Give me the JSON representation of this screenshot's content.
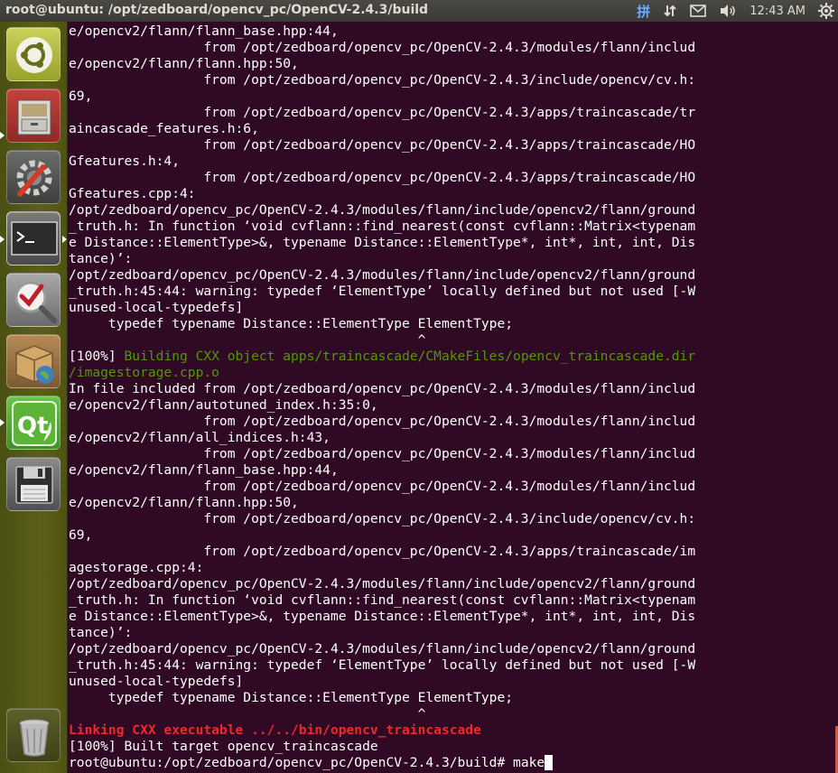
{
  "window": {
    "title": "root@ubuntu: /opt/zedboard/opencv_pc/OpenCV-2.4.3/build"
  },
  "indicators": {
    "keyboard": "拼",
    "clock": "12:43 AM"
  },
  "launcher": {
    "items": [
      {
        "name": "ubuntu-dash"
      },
      {
        "name": "file-manager"
      },
      {
        "name": "system-settings"
      },
      {
        "name": "terminal"
      },
      {
        "name": "qt-creator-check"
      },
      {
        "name": "software-center"
      },
      {
        "name": "qt-creator"
      },
      {
        "name": "save-disk"
      },
      {
        "name": "trash"
      }
    ]
  },
  "terminal": {
    "lines": [
      {
        "text": "e/opencv2/flann/flann_base.hpp:44,",
        "style": "normal"
      },
      {
        "text": "                 from /opt/zedboard/opencv_pc/OpenCV-2.4.3/modules/flann/includ",
        "style": "normal"
      },
      {
        "text": "e/opencv2/flann/flann.hpp:50,",
        "style": "normal"
      },
      {
        "text": "                 from /opt/zedboard/opencv_pc/OpenCV-2.4.3/include/opencv/cv.h:",
        "style": "normal"
      },
      {
        "text": "69,",
        "style": "normal"
      },
      {
        "text": "                 from /opt/zedboard/opencv_pc/OpenCV-2.4.3/apps/traincascade/tr",
        "style": "normal"
      },
      {
        "text": "aincascade_features.h:6,",
        "style": "normal"
      },
      {
        "text": "                 from /opt/zedboard/opencv_pc/OpenCV-2.4.3/apps/traincascade/HO",
        "style": "normal"
      },
      {
        "text": "Gfeatures.h:4,",
        "style": "normal"
      },
      {
        "text": "                 from /opt/zedboard/opencv_pc/OpenCV-2.4.3/apps/traincascade/HO",
        "style": "normal"
      },
      {
        "text": "Gfeatures.cpp:4:",
        "style": "normal"
      },
      {
        "text": "/opt/zedboard/opencv_pc/OpenCV-2.4.3/modules/flann/include/opencv2/flann/ground",
        "style": "normal"
      },
      {
        "text": "_truth.h: In function ‘void cvflann::find_nearest(const cvflann::Matrix<typenam",
        "style": "normal"
      },
      {
        "text": "e Distance::ElementType>&, typename Distance::ElementType*, int*, int, int, Dis",
        "style": "normal"
      },
      {
        "text": "tance)’:",
        "style": "normal"
      },
      {
        "text": "/opt/zedboard/opencv_pc/OpenCV-2.4.3/modules/flann/include/opencv2/flann/ground",
        "style": "normal"
      },
      {
        "text": "_truth.h:45:44: warning: typedef ‘ElementType’ locally defined but not used [-W",
        "style": "normal"
      },
      {
        "text": "unused-local-typedefs]",
        "style": "normal"
      },
      {
        "text": "     typedef typename Distance::ElementType ElementType;",
        "style": "normal"
      },
      {
        "text": "                                            ^",
        "style": "normal"
      },
      {
        "text": "[100%] Building CXX object apps/traincascade/CMakeFiles/opencv_traincascade.dir",
        "style": "green",
        "prefix": "[100%] "
      },
      {
        "text": "/imagestorage.cpp.o",
        "style": "green"
      },
      {
        "text": "In file included from /opt/zedboard/opencv_pc/OpenCV-2.4.3/modules/flann/includ",
        "style": "normal"
      },
      {
        "text": "e/opencv2/flann/autotuned_index.h:35:0,",
        "style": "normal"
      },
      {
        "text": "                 from /opt/zedboard/opencv_pc/OpenCV-2.4.3/modules/flann/includ",
        "style": "normal"
      },
      {
        "text": "e/opencv2/flann/all_indices.h:43,",
        "style": "normal"
      },
      {
        "text": "                 from /opt/zedboard/opencv_pc/OpenCV-2.4.3/modules/flann/includ",
        "style": "normal"
      },
      {
        "text": "e/opencv2/flann/flann_base.hpp:44,",
        "style": "normal"
      },
      {
        "text": "                 from /opt/zedboard/opencv_pc/OpenCV-2.4.3/modules/flann/includ",
        "style": "normal"
      },
      {
        "text": "e/opencv2/flann/flann.hpp:50,",
        "style": "normal"
      },
      {
        "text": "                 from /opt/zedboard/opencv_pc/OpenCV-2.4.3/include/opencv/cv.h:",
        "style": "normal"
      },
      {
        "text": "69,",
        "style": "normal"
      },
      {
        "text": "                 from /opt/zedboard/opencv_pc/OpenCV-2.4.3/apps/traincascade/im",
        "style": "normal"
      },
      {
        "text": "agestorage.cpp:4:",
        "style": "normal"
      },
      {
        "text": "/opt/zedboard/opencv_pc/OpenCV-2.4.3/modules/flann/include/opencv2/flann/ground",
        "style": "normal"
      },
      {
        "text": "_truth.h: In function ‘void cvflann::find_nearest(const cvflann::Matrix<typenam",
        "style": "normal"
      },
      {
        "text": "e Distance::ElementType>&, typename Distance::ElementType*, int*, int, int, Dis",
        "style": "normal"
      },
      {
        "text": "tance)’:",
        "style": "normal"
      },
      {
        "text": "/opt/zedboard/opencv_pc/OpenCV-2.4.3/modules/flann/include/opencv2/flann/ground",
        "style": "normal"
      },
      {
        "text": "_truth.h:45:44: warning: typedef ‘ElementType’ locally defined but not used [-W",
        "style": "normal"
      },
      {
        "text": "unused-local-typedefs]",
        "style": "normal"
      },
      {
        "text": "     typedef typename Distance::ElementType ElementType;",
        "style": "normal"
      },
      {
        "text": "                                            ^",
        "style": "normal"
      },
      {
        "text": "Linking CXX executable ../../bin/opencv_traincascade",
        "style": "red"
      },
      {
        "text": "[100%] Built target opencv_traincascade",
        "style": "normal"
      }
    ],
    "prompt": "root@ubuntu:/opt/zedboard/opencv_pc/OpenCV-2.4.3/build# ",
    "input": "make"
  },
  "colors": {
    "terminal_bg": "#300a24",
    "text": "#ffffff",
    "build_green": "#4e9a06",
    "link_red": "#ef2929",
    "accent_orange": "#e95420"
  }
}
